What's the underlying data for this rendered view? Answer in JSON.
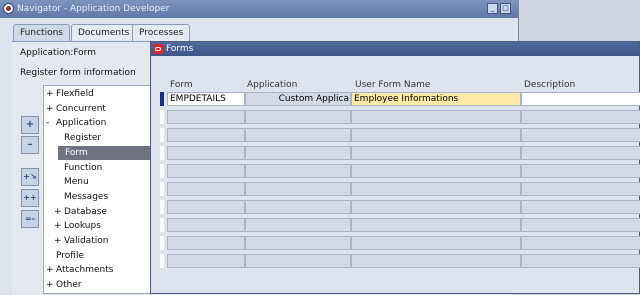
{
  "navigator": {
    "title": "Navigator - Application Developer",
    "tabs": [
      {
        "label": "Functions",
        "active": true
      },
      {
        "label": "Documents",
        "active": false
      },
      {
        "label": "Processes",
        "active": false
      }
    ],
    "header": "Application:Form",
    "subheader": "Register form information",
    "side_buttons": [
      {
        "icon": "plus-icon",
        "glyph": "+"
      },
      {
        "icon": "minus-icon",
        "glyph": "–"
      },
      {
        "icon": "expand-branch-icon",
        "glyph": "+↘"
      },
      {
        "icon": "expand-all-icon",
        "glyph": "++"
      },
      {
        "icon": "collapse-all-icon",
        "glyph": "=-"
      }
    ],
    "tree": [
      {
        "label": "Flexfield",
        "expander": "+",
        "level": 0
      },
      {
        "label": "Concurrent",
        "expander": "+",
        "level": 0
      },
      {
        "label": "Application",
        "expander": "-",
        "level": 0
      },
      {
        "label": "Register",
        "expander": "",
        "level": 1
      },
      {
        "label": "Form",
        "expander": "",
        "level": 1,
        "selected": true
      },
      {
        "label": "Function",
        "expander": "",
        "level": 1
      },
      {
        "label": "Menu",
        "expander": "",
        "level": 1
      },
      {
        "label": "Messages",
        "expander": "",
        "level": 1
      },
      {
        "label": "Database",
        "expander": "+",
        "level": 1
      },
      {
        "label": "Lookups",
        "expander": "+",
        "level": 1
      },
      {
        "label": "Validation",
        "expander": "+",
        "level": 1
      },
      {
        "label": "Profile",
        "expander": "",
        "level": 0
      },
      {
        "label": "Attachments",
        "expander": "+",
        "level": 0
      },
      {
        "label": "Other",
        "expander": "+",
        "level": 0
      }
    ]
  },
  "forms": {
    "title": "Forms",
    "columns": [
      "Form",
      "Application",
      "User Form Name",
      "Description"
    ],
    "rows": [
      {
        "form": "EMPDETAILS",
        "application": "Custom Applica",
        "user_form_name": "Employee Informations",
        "description": ""
      }
    ],
    "empty_row_count": 9
  },
  "colors": {
    "selected_tree_bg": "#6f7480",
    "required_field_bg": "#fde9a8",
    "current_record_marker": "#1c2f7a"
  }
}
